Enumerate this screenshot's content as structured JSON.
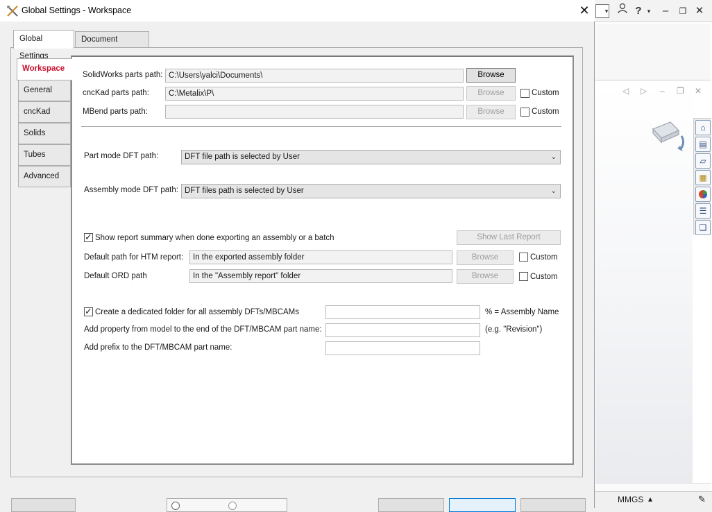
{
  "dialog": {
    "title": "Global Settings - Workspace",
    "close_glyph": "✕"
  },
  "outer_tabs": [
    {
      "label": "Global Settings",
      "active": true
    },
    {
      "label": "Document Settings",
      "active": false
    }
  ],
  "side_tabs": [
    {
      "label": "Workspace",
      "active": true
    },
    {
      "label": "General"
    },
    {
      "label": "cncKad"
    },
    {
      "label": "Solids"
    },
    {
      "label": "Tubes"
    },
    {
      "label": "Advanced"
    }
  ],
  "paths": {
    "solidworks": {
      "label": "SolidWorks parts path:",
      "value": "C:\\Users\\yalci\\Documents\\",
      "button": "Browse"
    },
    "cnckad": {
      "label": "cncKad parts path:",
      "value": "C:\\Metalix\\P\\",
      "button": "Browse",
      "custom": "Custom"
    },
    "mbend": {
      "label": "MBend parts path:",
      "value": "",
      "button": "Browse",
      "custom": "Custom"
    }
  },
  "dft": {
    "part_label": "Part mode DFT path:",
    "part_value": "DFT file path is selected by User",
    "assembly_label": "Assembly mode DFT path:",
    "assembly_value": "DFT files path is selected by User"
  },
  "report": {
    "show_summary_label": "Show report summary when done exporting an assembly or a batch",
    "show_summary_checked": true,
    "show_last_report": "Show Last Report",
    "htm_label": "Default path for HTM report:",
    "htm_value": "In the exported assembly folder",
    "htm_button": "Browse",
    "htm_custom": "Custom",
    "ord_label": "Default ORD path",
    "ord_value": "In the \"Assembly report\" folder",
    "ord_button": "Browse",
    "ord_custom": "Custom"
  },
  "naming": {
    "dedicated_label": "Create a dedicated folder for all assembly DFTs/MBCAMs",
    "dedicated_checked": true,
    "dedicated_value": "",
    "dedicated_hint": "% = Assembly Name",
    "property_label": "Add property from model to the end of the DFT/MBCAM part name:",
    "property_value": "",
    "property_hint": "(e.g. \"Revision\")",
    "prefix_label": "Add prefix to the DFT/MBCAM part name:",
    "prefix_value": ""
  },
  "background_app": {
    "status_units": "MMGS",
    "status_arrow": "▴"
  }
}
